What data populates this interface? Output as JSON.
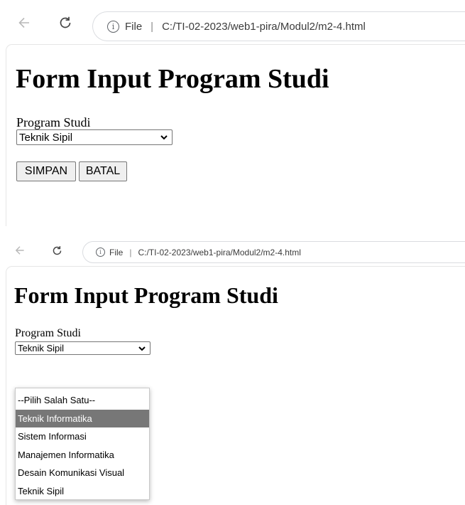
{
  "browser": {
    "info_symbol": "i",
    "scheme_label": "File",
    "separator": "|",
    "url": "C:/TI-02-2023/web1-pira/Modul2/m2-4.html"
  },
  "page": {
    "title": "Form Input Program Studi",
    "field_label": "Program Studi",
    "select_value": "Teknik Sipil",
    "buttons": {
      "save": "SIMPAN",
      "cancel": "BATAL"
    }
  },
  "dropdown": {
    "options": [
      "--Pilih Salah Satu--",
      "Teknik Informatika",
      "Sistem Informasi",
      "Manajemen Informatika",
      "Desain Komunikasi Visual",
      "Teknik Sipil"
    ],
    "highlighted": "Teknik Informatika"
  },
  "colors": {
    "highlight": "#777777",
    "border": "#767676",
    "button_bg": "#efefef"
  },
  "icons": {
    "back": "arrow-left-icon",
    "reload": "reload-icon",
    "info": "info-icon",
    "select_arrow": "chevron-down-icon"
  }
}
